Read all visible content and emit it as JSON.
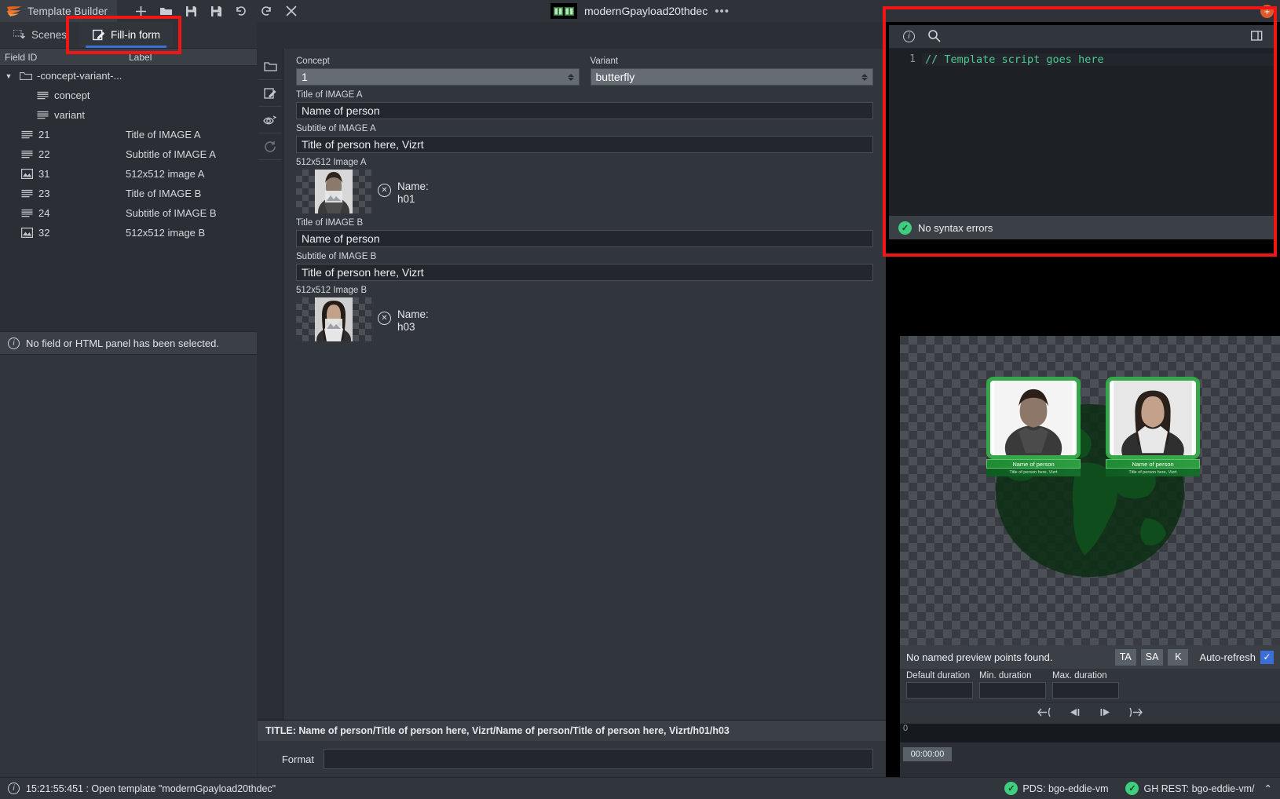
{
  "titlebar": {
    "brand": "Template Builder",
    "tools": [
      "new-icon",
      "open-folder-icon",
      "save-icon",
      "save-as-icon",
      "undo-icon",
      "redo-icon",
      "close-icon"
    ],
    "document_title": "modernGpayload20thdec",
    "overflow": "•••"
  },
  "left": {
    "tabs": [
      {
        "label": "Scenes",
        "icon": "scenes-icon",
        "active": false
      },
      {
        "label": "Fill-in form",
        "icon": "form-edit-icon",
        "active": true
      }
    ],
    "tree_headers": {
      "id": "Field ID",
      "label": "Label"
    },
    "tree": [
      {
        "id": "-concept-variant-...",
        "label": "",
        "icon": "folder-icon",
        "depth": 0,
        "caret": "▼"
      },
      {
        "id": "concept",
        "label": "",
        "icon": "text-lines-icon",
        "depth": 2
      },
      {
        "id": "variant",
        "label": "",
        "icon": "text-lines-icon",
        "depth": 2
      },
      {
        "id": "21",
        "label": "Title of IMAGE A",
        "icon": "text-lines-icon",
        "depth": 1
      },
      {
        "id": "22",
        "label": "Subtitle of IMAGE A",
        "icon": "text-lines-icon",
        "depth": 1
      },
      {
        "id": "31",
        "label": "512x512 image A",
        "icon": "image-icon",
        "depth": 1
      },
      {
        "id": "23",
        "label": "Title of IMAGE B",
        "icon": "text-lines-icon",
        "depth": 1
      },
      {
        "id": "24",
        "label": "Subtitle of IMAGE B",
        "icon": "text-lines-icon",
        "depth": 1
      },
      {
        "id": "32",
        "label": "512x512 image B",
        "icon": "image-icon",
        "depth": 1
      }
    ],
    "no_selection": "No field or HTML panel has been selected."
  },
  "rail": [
    "folder-panel-icon",
    "edit-panel-icon",
    "preview-eye-icon",
    "refresh-icon"
  ],
  "form": {
    "concept": {
      "label": "Concept",
      "value": "1"
    },
    "variant": {
      "label": "Variant",
      "value": "butterfly"
    },
    "fields": [
      {
        "label": "Title of IMAGE A",
        "value": "Name of person",
        "type": "text"
      },
      {
        "label": "Subtitle of IMAGE A",
        "value": "Title of person here, Vizrt",
        "type": "text"
      },
      {
        "label": "512x512 Image A",
        "value": "h01",
        "name_label": "Name:",
        "type": "image"
      },
      {
        "label": "Title of IMAGE B",
        "value": "Name of person",
        "type": "text"
      },
      {
        "label": "Subtitle of IMAGE B",
        "value": "Title of person here, Vizrt",
        "type": "text"
      },
      {
        "label": "512x512 Image B",
        "value": "h03",
        "name_label": "Name:",
        "type": "image"
      }
    ],
    "title_strip": "TITLE: Name of person/Title of person here, Vizrt/Name of person/Title of person here, Vizrt/h01/h03",
    "format": {
      "label": "Format",
      "value": "",
      "placeholder": ""
    }
  },
  "editor": {
    "toolbar": [
      "info-icon",
      "search-icon",
      "detach-icon"
    ],
    "line_numbers": [
      "1"
    ],
    "code": "// Template script goes here",
    "status": "No syntax errors",
    "status_icon": "check-circle-icon"
  },
  "preview": {
    "cards": [
      {
        "title": "Name of person",
        "subtitle": "Title of person here, Vizrt"
      },
      {
        "title": "Name of person",
        "subtitle": "Title of person here, Vizrt"
      }
    ],
    "points_message": "No named preview points found.",
    "buttons": [
      "TA",
      "SA",
      "K"
    ],
    "auto_refresh": {
      "label": "Auto-refresh",
      "checked": true
    },
    "durations": [
      {
        "label": "Default duration",
        "value": ""
      },
      {
        "label": "Min. duration",
        "value": ""
      },
      {
        "label": "Max. duration",
        "value": ""
      }
    ],
    "transport": [
      "jump-start-icon",
      "step-back-icon",
      "play-icon",
      "jump-end-icon"
    ],
    "timeline_start": "0",
    "timecode": "00:00:00"
  },
  "status": {
    "message": "15:21:55:451 : Open template \"modernGpayload20thdec\"",
    "pds": "PDS: bgo-eddie-vm",
    "gh": "GH REST: bgo-eddie-vm/",
    "collapse": "⌃"
  },
  "colors": {
    "accent_blue": "#3a6fd8",
    "brand_orange": "#e05a2b",
    "ok_green": "#3ece7e",
    "highlight_red": "#f01616",
    "code_green": "#4ec98e"
  }
}
